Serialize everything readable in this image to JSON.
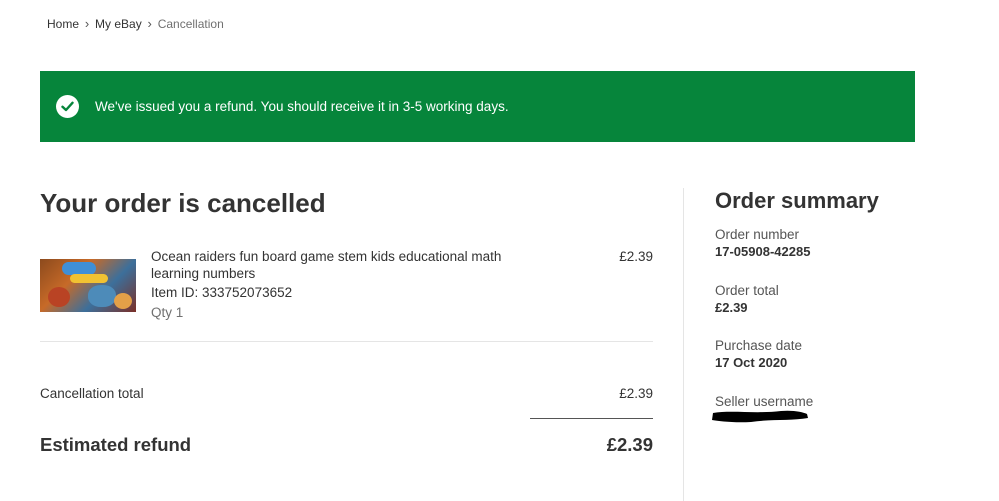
{
  "breadcrumb": {
    "items": [
      "Home",
      "My eBay"
    ],
    "current": "Cancellation"
  },
  "banner": {
    "message": "We've issued you a refund. You should receive it in 3-5 working days.",
    "color": "#06853b",
    "icon": "check-circle-icon"
  },
  "main": {
    "title": "Your order is cancelled",
    "item": {
      "title": "Ocean raiders fun board game stem kids educational math learning numbers",
      "item_id": "Item ID: 333752073652",
      "qty": "Qty 1",
      "price": "£2.39",
      "image_label": "Ocean Raiders"
    },
    "cancellation_total": {
      "label": "Cancellation total",
      "value": "£2.39"
    },
    "estimated_refund": {
      "label": "Estimated refund",
      "value": "£2.39"
    }
  },
  "summary": {
    "title": "Order summary",
    "order_number": {
      "label": "Order number",
      "value": "17-05908-42285"
    },
    "order_total": {
      "label": "Order total",
      "value": "£2.39"
    },
    "purchase_date": {
      "label": "Purchase date",
      "value": "17 Oct 2020"
    },
    "seller": {
      "label": "Seller username"
    }
  }
}
